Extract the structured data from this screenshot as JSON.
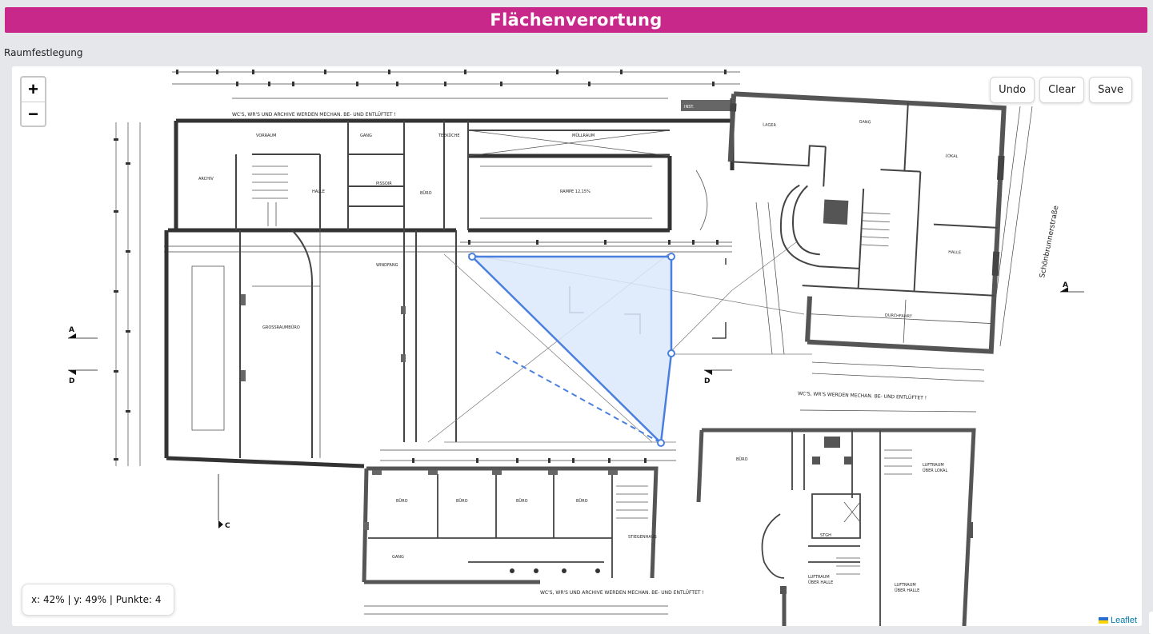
{
  "header": {
    "title": "Flächenverortung"
  },
  "section": {
    "label": "Raumfestlegung"
  },
  "map": {
    "zoom_in_label": "+",
    "zoom_out_label": "−",
    "tools": {
      "undo_label": "Undo",
      "clear_label": "Clear",
      "save_label": "Save"
    },
    "status_text": "x: 42% | y: 49% | Punkte: 4",
    "attribution": "Leaflet",
    "polygon_color": "#4a7fe0",
    "polygon_fill": "#dbe7fb"
  },
  "floorplan": {
    "top_note": "WC'S, WR'S UND ARCHIVE   WERDEN MECHAN. BE- UND ENTLÜFTET !",
    "right_note": "WC'S, WR'S  WERDEN MECHAN. BE- UND ENTLÜFTET !",
    "bottom_note": "WC'S, WR'S UND ARCHIVE   WERDEN MECHAN. BE- UND ENTLÜFTET !",
    "street_name": "Schönbrunnerstraße",
    "section_labels": {
      "a_left": "A",
      "a_right": "A",
      "d_left": "D",
      "d_right": "D",
      "c": "C"
    },
    "rooms": {
      "archiv": "ARCHIV",
      "vorraum": "VORRAUM",
      "gang": "GANG",
      "teekueche": "TEEKÜCHE",
      "muellraum": "MÜLLRAUM",
      "rampe": "RAMPE 12,15%",
      "halle": "HALLE",
      "buero": "BÜRO",
      "pissoir": "PISSOIR",
      "windfang": "WINDFANG",
      "grossraumbuero": "GROSSRAUMBÜRO",
      "lager": "LAGER",
      "lokal": "LOKAL",
      "durchfahrt": "DURCHFAHRT",
      "stiegenhaus": "STIEGENHAUS",
      "luftraum_lokal": "LUFTRAUM ÜBER LOKAL",
      "luftraum_halle": "LUFTRAUM ÜBER HALLE",
      "stiege": "STGH"
    }
  }
}
